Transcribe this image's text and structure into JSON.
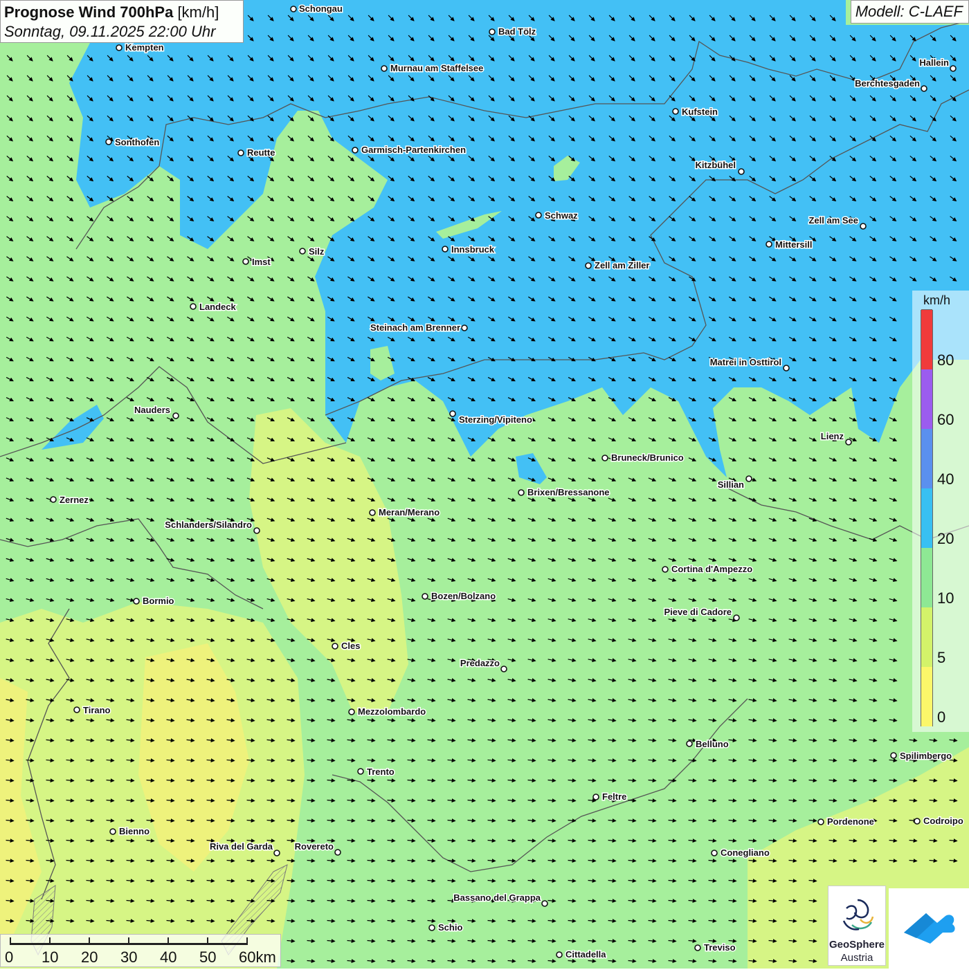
{
  "title": {
    "main": "Prognose Wind 700hPa",
    "unit": "[km/h]",
    "datetime": "Sonntag, 09.11.2025 22:00 Uhr"
  },
  "model": "Modell: C-LAEF",
  "legend": {
    "unit": "km/h",
    "ticks": [
      "0",
      "5",
      "10",
      "20",
      "40",
      "60",
      "80"
    ],
    "colors": [
      "#fbf76a",
      "#d3f36a",
      "#8ee894",
      "#38c0f2",
      "#5a90ee",
      "#9b5cef",
      "#f03b3b"
    ],
    "top_color": "#c9ecff"
  },
  "map_colors": {
    "yellow": "#eef27c",
    "green": "#a6ef9c",
    "light_green": "#b2f1ac",
    "blue": "#43c0f5",
    "border": "#555555"
  },
  "wind_arrow_direction": "towards south-east in the north, south in the south",
  "cities": [
    {
      "name": "Schongau"
    },
    {
      "name": "Bad Tölz"
    },
    {
      "name": "Kempten"
    },
    {
      "name": "Murnau am Staffelsee"
    },
    {
      "name": "Hallein"
    },
    {
      "name": "Berchtesgaden"
    },
    {
      "name": "Kufstein"
    },
    {
      "name": "Sonthofen"
    },
    {
      "name": "Reutte"
    },
    {
      "name": "Garmisch-Partenkirchen"
    },
    {
      "name": "Kitzbühel"
    },
    {
      "name": "Schwaz"
    },
    {
      "name": "Zell am See"
    },
    {
      "name": "Innsbruck"
    },
    {
      "name": "Mittersill"
    },
    {
      "name": "Silz"
    },
    {
      "name": "Imst"
    },
    {
      "name": "Zell am Ziller"
    },
    {
      "name": "Landeck"
    },
    {
      "name": "Steinach am Brenner"
    },
    {
      "name": "Matrei in Osttirol"
    },
    {
      "name": "Nauders"
    },
    {
      "name": "Sterzing/Vipiteno"
    },
    {
      "name": "Lienz"
    },
    {
      "name": "Bruneck/Brunico"
    },
    {
      "name": "Sillian"
    },
    {
      "name": "Brixen/Bressanone"
    },
    {
      "name": "Zernez"
    },
    {
      "name": "Meran/Merano"
    },
    {
      "name": "Schlanders/Silandro"
    },
    {
      "name": "Cortina d'Ampezzo"
    },
    {
      "name": "Bozen/Bolzano"
    },
    {
      "name": "Bormio"
    },
    {
      "name": "Pieve di Cadore"
    },
    {
      "name": "Cles"
    },
    {
      "name": "Predazzo"
    },
    {
      "name": "Tirano"
    },
    {
      "name": "Mezzolombardo"
    },
    {
      "name": "Belluno"
    },
    {
      "name": "Spilimbergo"
    },
    {
      "name": "Trento"
    },
    {
      "name": "Feltre"
    },
    {
      "name": "Pordenone"
    },
    {
      "name": "Codroipo"
    },
    {
      "name": "Bienno"
    },
    {
      "name": "Riva del Garda"
    },
    {
      "name": "Rovereto"
    },
    {
      "name": "Conegliano"
    },
    {
      "name": "Bassano del Grappa"
    },
    {
      "name": "Schio"
    },
    {
      "name": "Treviso"
    },
    {
      "name": "Cittadella"
    }
  ],
  "scale": {
    "labels": [
      "0",
      "10",
      "20",
      "30",
      "40",
      "50",
      "60km"
    ]
  },
  "logo": {
    "brand": "GeoSphere",
    "sub": "Austria"
  }
}
